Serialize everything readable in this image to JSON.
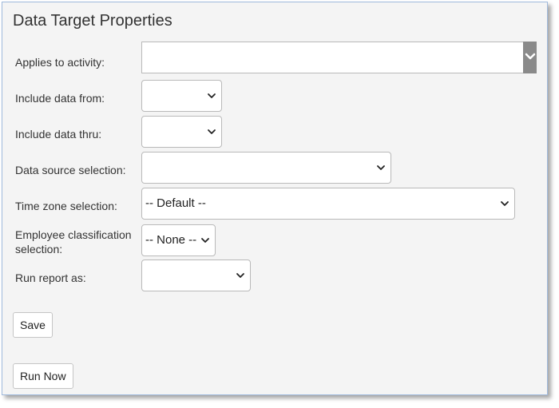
{
  "dialog": {
    "title": "Data Target Properties"
  },
  "fields": {
    "applies_to_activity": {
      "label": "Applies to activity:",
      "value": ""
    },
    "include_data_from": {
      "label": "Include data from:",
      "value": ""
    },
    "include_data_thru": {
      "label": "Include data thru:",
      "value": ""
    },
    "data_source_selection": {
      "label": "Data source selection:",
      "value": ""
    },
    "time_zone_selection": {
      "label": "Time zone selection:",
      "value": "-- Default --"
    },
    "employee_classification": {
      "label_line1": "Employee classification",
      "label_line2": "selection:",
      "value": "-- None --"
    },
    "run_report_as": {
      "label": "Run report as:",
      "value": ""
    }
  },
  "buttons": {
    "save_label": "Save",
    "run_now_label": "Run Now"
  },
  "icons": {
    "dropdown": "chevron-down-icon"
  },
  "colors": {
    "panel_bg": "#f4f4f4",
    "panel_border": "#9fb9dc",
    "dropdown_block": "#8a8a8a"
  }
}
